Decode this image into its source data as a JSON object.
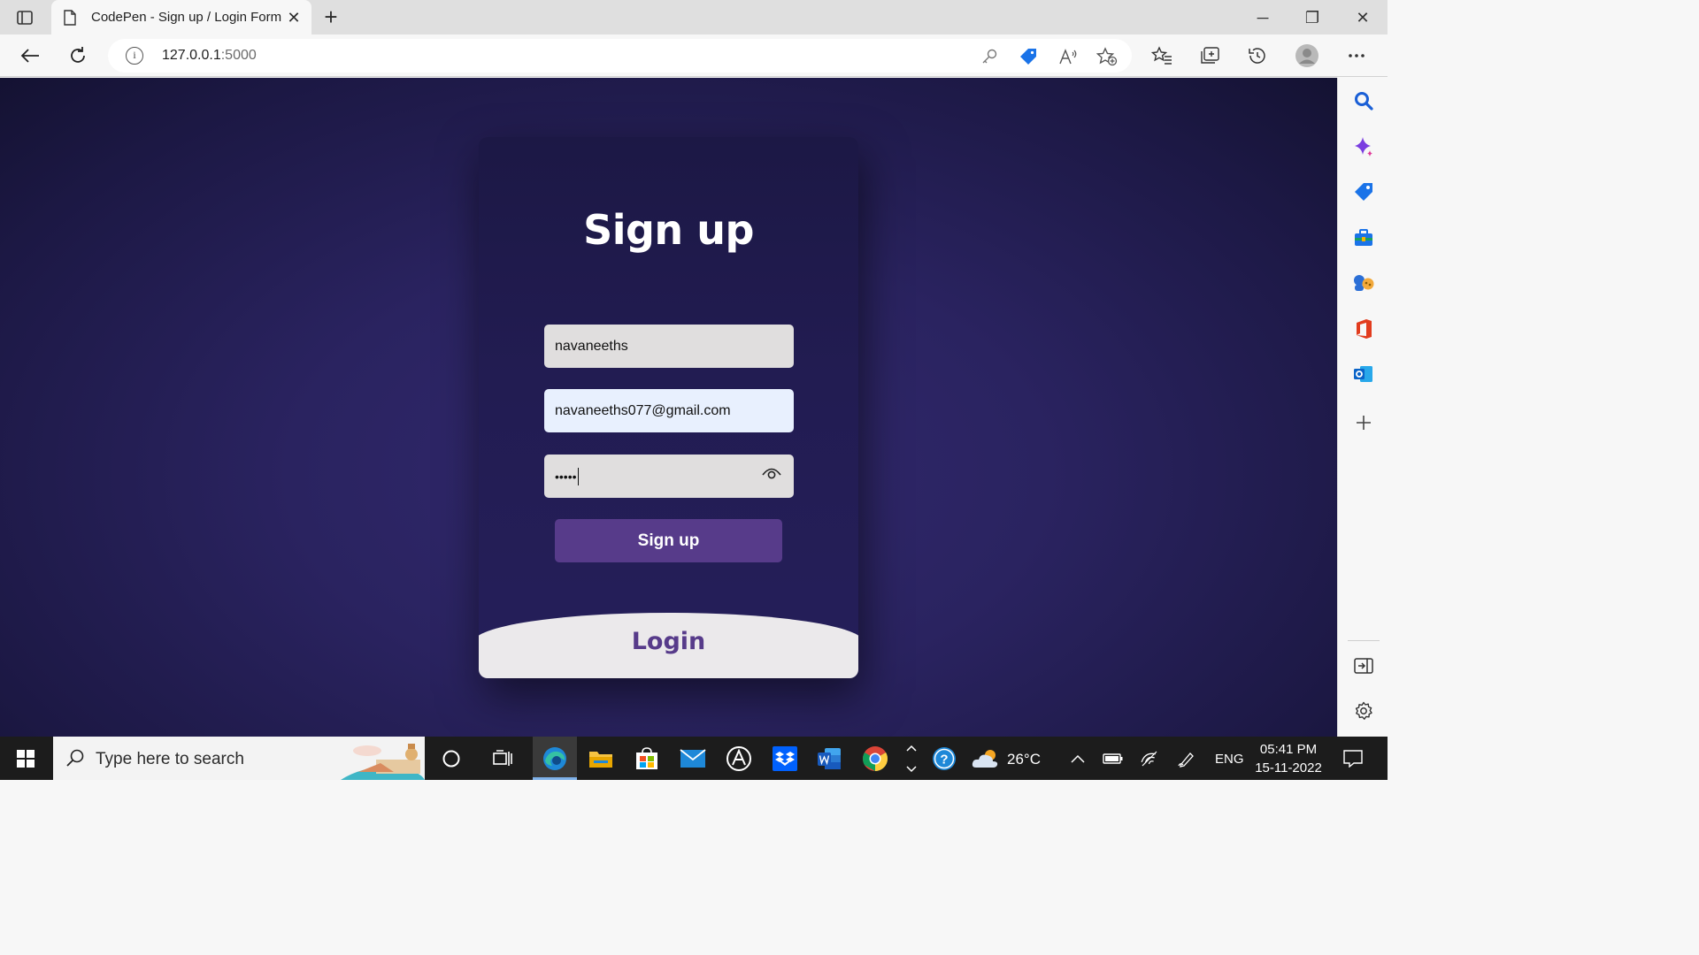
{
  "browser": {
    "tab_title": "CodePen - Sign up / Login Form",
    "tab_close_glyph": "✕",
    "new_tab_glyph": "+",
    "url_host": "127.0.0.1",
    "url_port": ":5000",
    "window_controls": [
      "─",
      "❐",
      "✕"
    ]
  },
  "page": {
    "signup_title": "Sign up",
    "username_value": "navaneeths",
    "email_value": "navaneeths077@gmail.com",
    "password_mask": "•••••",
    "signup_button": "Sign up",
    "login_title": "Login"
  },
  "taskbar": {
    "search_placeholder": "Type here to search",
    "weather": "26°C",
    "language": "ENG",
    "time": "05:41 PM",
    "date": "15-11-2022"
  },
  "colors": {
    "accent_purple": "#573b8a",
    "background_dark": "#1c1844"
  }
}
